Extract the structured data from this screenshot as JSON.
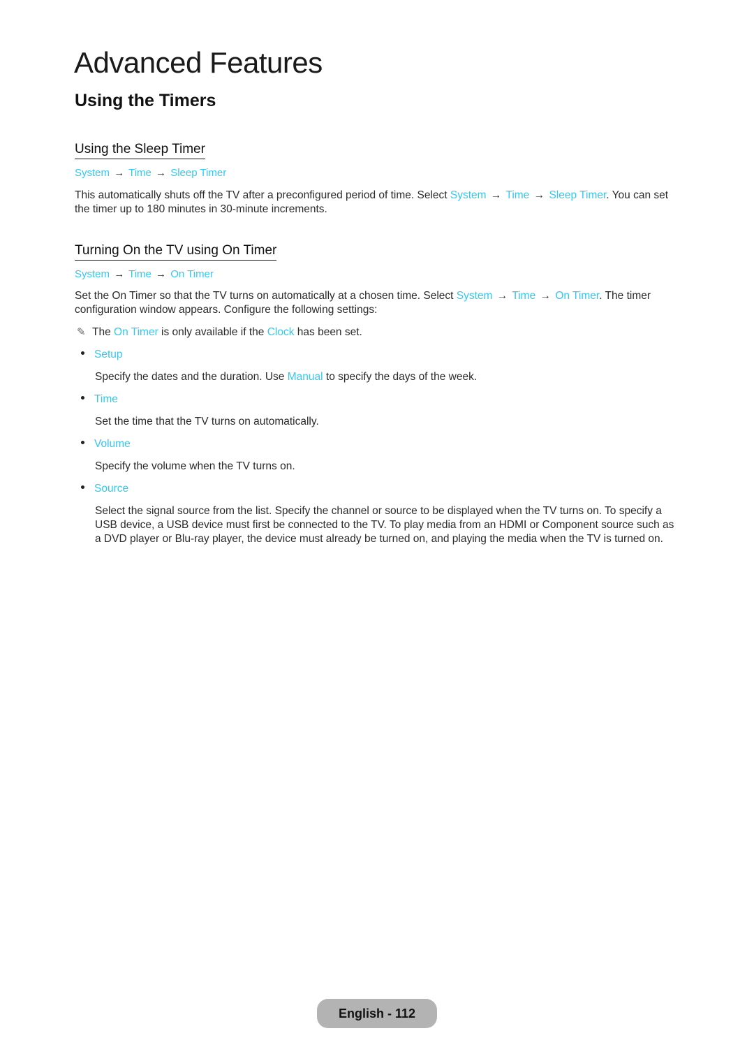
{
  "page": {
    "title": "Advanced Features",
    "section_title": "Using the Timers"
  },
  "sleep_timer": {
    "heading": "Using the Sleep Timer",
    "menu_path": [
      "System",
      "Time",
      "Sleep Timer"
    ],
    "arrow": "→",
    "paragraph": {
      "text_before": "This automatically shuts off the TV after a preconfigured period of time. Select ",
      "path": [
        "System",
        "Time",
        "Sleep Timer"
      ],
      "text_after": ". You can set the timer up to 180 minutes in 30-minute increments."
    }
  },
  "on_timer": {
    "heading": "Turning On the TV using On Timer",
    "menu_path": [
      "System",
      "Time",
      "On Timer"
    ],
    "arrow": "→",
    "paragraph": {
      "text_before": "Set the On Timer so that the TV turns on automatically at a chosen time. Select ",
      "path": [
        "System",
        "Time",
        "On Timer"
      ],
      "text_after": ". The timer configuration window appears. Configure the following settings:"
    },
    "note": {
      "icon": "pencil-note-icon",
      "glyph": "✎",
      "part1": "The ",
      "link1": "On Timer",
      "part2": " is only available if the ",
      "link2": "Clock",
      "part3": " has been set."
    },
    "settings": [
      {
        "label": "Setup",
        "desc_before": "Specify the dates and the duration. Use ",
        "desc_link": "Manual",
        "desc_after": " to specify the days of the week."
      },
      {
        "label": "Time",
        "desc_before": "Set the time that the TV turns on automatically.",
        "desc_link": "",
        "desc_after": ""
      },
      {
        "label": "Volume",
        "desc_before": "Specify the volume when the TV turns on.",
        "desc_link": "",
        "desc_after": ""
      },
      {
        "label": "Source",
        "desc_before": "Select the signal source from the list. Specify the channel or source to be displayed when the TV turns on. To specify a USB device, a USB device must first be connected to the TV. To play media from an HDMI or Component source such as a DVD player or Blu-ray player, the device must already be turned on, and playing the media when the TV is turned on.",
        "desc_link": "",
        "desc_after": ""
      }
    ]
  },
  "footer": {
    "label": "English - 112"
  },
  "colors": {
    "accent": "#33c8ee",
    "footer_pill": "#b3b3b3"
  }
}
